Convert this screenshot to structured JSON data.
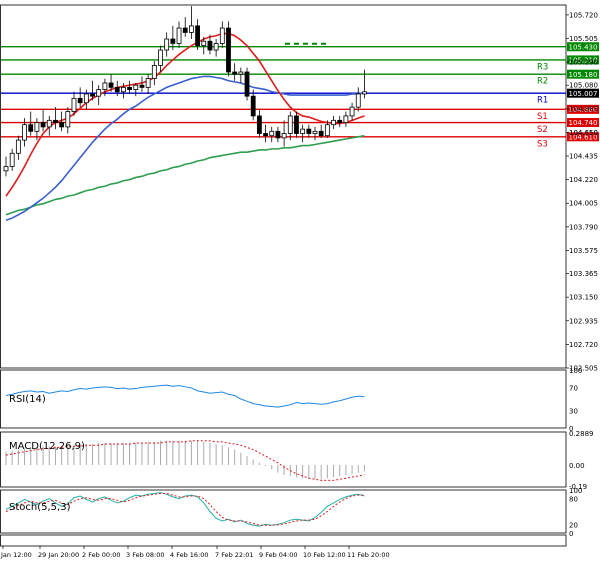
{
  "chart_data": {
    "type": "candlestick",
    "price_axis": {
      "ticks": [
        "105.720",
        "105.505",
        "105.290",
        "105.080",
        "104.865",
        "104.650",
        "104.435",
        "104.220",
        "104.005",
        "103.790",
        "103.575",
        "103.365",
        "103.150",
        "102.935",
        "102.720",
        "102.505"
      ],
      "ylim": [
        102.505,
        105.81
      ]
    },
    "date_labels": [
      "Jan 12:00",
      "29 Jan 20:00",
      "2 Feb 00:00",
      "3 Feb 08:00",
      "4 Feb 16:00",
      "7 Feb 22:01",
      "9 Feb 04:00",
      "10 Feb 12:00",
      "11 Feb 20:00"
    ],
    "candles": [
      {
        "o": 104.3,
        "h": 104.43,
        "l": 104.25,
        "c": 104.34
      },
      {
        "o": 104.34,
        "h": 104.5,
        "l": 104.3,
        "c": 104.46
      },
      {
        "o": 104.46,
        "h": 104.62,
        "l": 104.4,
        "c": 104.58
      },
      {
        "o": 104.58,
        "h": 104.78,
        "l": 104.52,
        "c": 104.72
      },
      {
        "o": 104.72,
        "h": 104.84,
        "l": 104.62,
        "c": 104.66
      },
      {
        "o": 104.66,
        "h": 104.78,
        "l": 104.58,
        "c": 104.74
      },
      {
        "o": 104.74,
        "h": 104.86,
        "l": 104.66,
        "c": 104.7
      },
      {
        "o": 104.7,
        "h": 104.8,
        "l": 104.62,
        "c": 104.76
      },
      {
        "o": 104.76,
        "h": 104.88,
        "l": 104.68,
        "c": 104.74
      },
      {
        "o": 104.74,
        "h": 104.84,
        "l": 104.66,
        "c": 104.7
      },
      {
        "o": 104.7,
        "h": 104.88,
        "l": 104.64,
        "c": 104.84
      },
      {
        "o": 104.84,
        "h": 105.02,
        "l": 104.8,
        "c": 104.96
      },
      {
        "o": 104.96,
        "h": 105.06,
        "l": 104.88,
        "c": 104.92
      },
      {
        "o": 104.92,
        "h": 105.04,
        "l": 104.86,
        "c": 105.0
      },
      {
        "o": 105.0,
        "h": 105.12,
        "l": 104.94,
        "c": 104.98
      },
      {
        "o": 104.98,
        "h": 105.08,
        "l": 104.9,
        "c": 105.04
      },
      {
        "o": 105.04,
        "h": 105.14,
        "l": 104.98,
        "c": 105.1
      },
      {
        "o": 105.1,
        "h": 105.18,
        "l": 105.02,
        "c": 105.06
      },
      {
        "o": 105.06,
        "h": 105.12,
        "l": 104.98,
        "c": 105.02
      },
      {
        "o": 105.02,
        "h": 105.1,
        "l": 104.96,
        "c": 105.06
      },
      {
        "o": 105.06,
        "h": 105.12,
        "l": 105.0,
        "c": 105.04
      },
      {
        "o": 105.04,
        "h": 105.1,
        "l": 104.98,
        "c": 105.08
      },
      {
        "o": 105.08,
        "h": 105.16,
        "l": 105.02,
        "c": 105.06
      },
      {
        "o": 105.06,
        "h": 105.18,
        "l": 105.0,
        "c": 105.14
      },
      {
        "o": 105.14,
        "h": 105.3,
        "l": 105.08,
        "c": 105.26
      },
      {
        "o": 105.26,
        "h": 105.44,
        "l": 105.2,
        "c": 105.4
      },
      {
        "o": 105.4,
        "h": 105.56,
        "l": 105.34,
        "c": 105.5
      },
      {
        "o": 105.5,
        "h": 105.62,
        "l": 105.4,
        "c": 105.46
      },
      {
        "o": 105.46,
        "h": 105.66,
        "l": 105.42,
        "c": 105.6
      },
      {
        "o": 105.6,
        "h": 105.7,
        "l": 105.52,
        "c": 105.56
      },
      {
        "o": 105.56,
        "h": 105.8,
        "l": 105.5,
        "c": 105.62
      },
      {
        "o": 105.62,
        "h": 105.68,
        "l": 105.4,
        "c": 105.44
      },
      {
        "o": 105.44,
        "h": 105.52,
        "l": 105.36,
        "c": 105.48
      },
      {
        "o": 105.48,
        "h": 105.54,
        "l": 105.36,
        "c": 105.4
      },
      {
        "o": 105.4,
        "h": 105.5,
        "l": 105.34,
        "c": 105.46
      },
      {
        "o": 105.46,
        "h": 105.66,
        "l": 105.42,
        "c": 105.6
      },
      {
        "o": 105.6,
        "h": 105.66,
        "l": 105.16,
        "c": 105.2
      },
      {
        "o": 105.2,
        "h": 105.28,
        "l": 105.12,
        "c": 105.18
      },
      {
        "o": 105.18,
        "h": 105.24,
        "l": 105.1,
        "c": 105.2
      },
      {
        "o": 105.2,
        "h": 105.24,
        "l": 104.94,
        "c": 104.98
      },
      {
        "o": 104.98,
        "h": 105.04,
        "l": 104.76,
        "c": 104.8
      },
      {
        "o": 104.8,
        "h": 104.86,
        "l": 104.6,
        "c": 104.64
      },
      {
        "o": 104.64,
        "h": 104.72,
        "l": 104.56,
        "c": 104.62
      },
      {
        "o": 104.62,
        "h": 104.7,
        "l": 104.56,
        "c": 104.66
      },
      {
        "o": 104.66,
        "h": 104.7,
        "l": 104.56,
        "c": 104.6
      },
      {
        "o": 104.6,
        "h": 104.76,
        "l": 104.52,
        "c": 104.64
      },
      {
        "o": 104.64,
        "h": 104.84,
        "l": 104.58,
        "c": 104.8
      },
      {
        "o": 104.8,
        "h": 104.84,
        "l": 104.6,
        "c": 104.64
      },
      {
        "o": 104.64,
        "h": 104.72,
        "l": 104.56,
        "c": 104.68
      },
      {
        "o": 104.68,
        "h": 104.72,
        "l": 104.6,
        "c": 104.64
      },
      {
        "o": 104.64,
        "h": 104.7,
        "l": 104.58,
        "c": 104.66
      },
      {
        "o": 104.66,
        "h": 104.72,
        "l": 104.6,
        "c": 104.62
      },
      {
        "o": 104.62,
        "h": 104.76,
        "l": 104.6,
        "c": 104.72
      },
      {
        "o": 104.72,
        "h": 104.8,
        "l": 104.68,
        "c": 104.76
      },
      {
        "o": 104.76,
        "h": 104.8,
        "l": 104.7,
        "c": 104.74
      },
      {
        "o": 104.74,
        "h": 104.84,
        "l": 104.7,
        "c": 104.8
      },
      {
        "o": 104.8,
        "h": 104.92,
        "l": 104.76,
        "c": 104.88
      },
      {
        "o": 104.88,
        "h": 105.06,
        "l": 104.84,
        "c": 105.0
      },
      {
        "o": 105.0,
        "h": 105.22,
        "l": 104.96,
        "c": 105.02
      }
    ],
    "ma_fast": [
      104.07,
      104.15,
      104.24,
      104.34,
      104.45,
      104.55,
      104.64,
      104.7,
      104.74,
      104.76,
      104.78,
      104.82,
      104.87,
      104.92,
      104.96,
      104.99,
      105.02,
      105.04,
      105.06,
      105.07,
      105.08,
      105.09,
      105.1,
      105.12,
      105.15,
      105.2,
      105.26,
      105.31,
      105.36,
      105.4,
      105.44,
      105.47,
      105.5,
      105.52,
      105.53,
      105.55,
      105.55,
      105.53,
      105.49,
      105.44,
      105.37,
      105.3,
      105.21,
      105.12,
      105.03,
      104.95,
      104.88,
      104.83,
      104.8,
      104.79,
      104.77,
      104.75,
      104.74,
      104.73,
      104.73,
      104.74,
      104.76,
      104.78,
      104.8
    ],
    "ma_mid": [
      103.85,
      103.87,
      103.9,
      103.93,
      103.97,
      104.01,
      104.05,
      104.1,
      104.15,
      104.21,
      104.28,
      104.35,
      104.42,
      104.49,
      104.56,
      104.62,
      104.68,
      104.73,
      104.77,
      104.82,
      104.86,
      104.89,
      104.93,
      104.97,
      105.0,
      105.03,
      105.06,
      105.08,
      105.1,
      105.12,
      105.14,
      105.15,
      105.16,
      105.16,
      105.15,
      105.14,
      105.12,
      105.11,
      105.1,
      105.08,
      105.06,
      105.05,
      105.04,
      105.02,
      105.01,
      105.0,
      104.99,
      104.99,
      104.99,
      104.99,
      104.99,
      104.99,
      104.99,
      104.99,
      104.99,
      104.99,
      105.0,
      105.0,
      105.01
    ],
    "ma_slow": [
      103.9,
      103.92,
      103.94,
      103.95,
      103.97,
      103.99,
      104.0,
      104.02,
      104.04,
      104.05,
      104.07,
      104.08,
      104.1,
      104.12,
      104.13,
      104.15,
      104.16,
      104.18,
      104.19,
      104.21,
      104.22,
      104.24,
      104.25,
      104.27,
      104.28,
      104.3,
      104.31,
      104.33,
      104.34,
      104.36,
      104.37,
      104.39,
      104.4,
      104.42,
      104.43,
      104.44,
      104.45,
      104.46,
      104.47,
      104.47,
      104.48,
      104.49,
      104.49,
      104.5,
      104.5,
      104.51,
      104.51,
      104.52,
      104.53,
      104.53,
      104.54,
      104.55,
      104.56,
      104.57,
      104.58,
      104.59,
      104.6,
      104.61,
      104.62
    ],
    "levels": [
      {
        "tag": "R3",
        "price": "105.310",
        "value": 105.31,
        "color": "#008800",
        "price_bg": "#008800"
      },
      {
        "tag": "R2",
        "price": "105.180",
        "value": 105.18,
        "color": "#008800",
        "price_bg": "#008800"
      },
      {
        "tag": "R1",
        "price": "105.007",
        "value": 105.007,
        "color": "#0000cc",
        "price_bg": "#000000"
      },
      {
        "tag": "S1",
        "price": "104.860",
        "value": 104.86,
        "color": "#dd0000",
        "price_bg": "#dd0000"
      },
      {
        "tag": "S2",
        "price": "104.740",
        "value": 104.74,
        "color": "#dd0000",
        "price_bg": "#dd0000"
      },
      {
        "tag": "S3",
        "price": "104.610",
        "value": 104.61,
        "color": "#dd0000",
        "price_bg": "#dd0000"
      }
    ],
    "top_level": {
      "price": "105.430",
      "value": 105.43,
      "color": "#008800"
    },
    "partial_tick": "104.650",
    "rsi": {
      "label": "RSI(14)",
      "ticks": [
        "100",
        "70",
        "30",
        "0"
      ],
      "values": [
        56,
        58,
        61,
        63,
        64,
        62,
        63,
        60,
        62,
        64,
        63,
        66,
        68,
        67,
        69,
        70,
        71,
        70,
        68,
        69,
        67,
        68,
        70,
        71,
        72,
        73,
        74,
        72,
        73,
        71,
        69,
        64,
        62,
        60,
        61,
        62,
        58,
        56,
        50,
        46,
        42,
        40,
        38,
        37,
        36,
        38,
        40,
        44,
        42,
        43,
        42,
        41,
        42,
        45,
        47,
        50,
        53,
        55,
        54
      ]
    },
    "macd": {
      "label": "MACD(12,26,9)",
      "ticks": [
        "0.2889",
        "0.00",
        "-0.19"
      ],
      "ylim": [
        -0.2,
        0.3
      ],
      "histogram": [
        0.12,
        0.13,
        0.14,
        0.15,
        0.16,
        0.16,
        0.17,
        0.17,
        0.17,
        0.17,
        0.18,
        0.18,
        0.19,
        0.19,
        0.19,
        0.2,
        0.2,
        0.2,
        0.2,
        0.2,
        0.2,
        0.2,
        0.2,
        0.21,
        0.21,
        0.22,
        0.22,
        0.22,
        0.22,
        0.22,
        0.22,
        0.22,
        0.21,
        0.2,
        0.19,
        0.18,
        0.16,
        0.14,
        0.11,
        0.08,
        0.05,
        0.02,
        -0.01,
        -0.04,
        -0.07,
        -0.09,
        -0.1,
        -0.11,
        -0.12,
        -0.13,
        -0.13,
        -0.13,
        -0.12,
        -0.11,
        -0.1,
        -0.09,
        -0.08,
        -0.07,
        -0.06
      ],
      "signal": [
        0.09,
        0.1,
        0.11,
        0.12,
        0.13,
        0.14,
        0.15,
        0.15,
        0.16,
        0.16,
        0.17,
        0.17,
        0.17,
        0.18,
        0.18,
        0.18,
        0.19,
        0.19,
        0.19,
        0.19,
        0.19,
        0.2,
        0.2,
        0.2,
        0.2,
        0.2,
        0.21,
        0.21,
        0.21,
        0.21,
        0.22,
        0.22,
        0.22,
        0.22,
        0.21,
        0.21,
        0.2,
        0.19,
        0.18,
        0.16,
        0.14,
        0.11,
        0.08,
        0.05,
        0.02,
        -0.02,
        -0.05,
        -0.08,
        -0.1,
        -0.12,
        -0.13,
        -0.14,
        -0.14,
        -0.14,
        -0.13,
        -0.12,
        -0.11,
        -0.1,
        -0.09
      ]
    },
    "stoch": {
      "label": "Stoch(5,5,3)",
      "ticks": [
        "100",
        "80",
        "20",
        "0"
      ],
      "k": [
        55,
        62,
        70,
        78,
        72,
        66,
        74,
        80,
        70,
        62,
        68,
        82,
        86,
        78,
        72,
        80,
        84,
        76,
        70,
        74,
        82,
        88,
        86,
        90,
        92,
        94,
        90,
        84,
        80,
        86,
        88,
        84,
        70,
        50,
        34,
        28,
        32,
        26,
        30,
        22,
        18,
        16,
        20,
        18,
        20,
        24,
        30,
        32,
        30,
        28,
        36,
        48,
        62,
        70,
        78,
        84,
        88,
        90,
        86
      ],
      "d": [
        50,
        56,
        64,
        70,
        74,
        70,
        70,
        74,
        76,
        70,
        66,
        74,
        80,
        82,
        78,
        76,
        80,
        80,
        76,
        72,
        76,
        82,
        86,
        88,
        90,
        92,
        92,
        88,
        84,
        84,
        86,
        86,
        80,
        66,
        50,
        36,
        30,
        28,
        28,
        26,
        22,
        18,
        18,
        18,
        19,
        21,
        25,
        28,
        30,
        30,
        32,
        40,
        50,
        62,
        72,
        80,
        86,
        88,
        88
      ]
    }
  }
}
